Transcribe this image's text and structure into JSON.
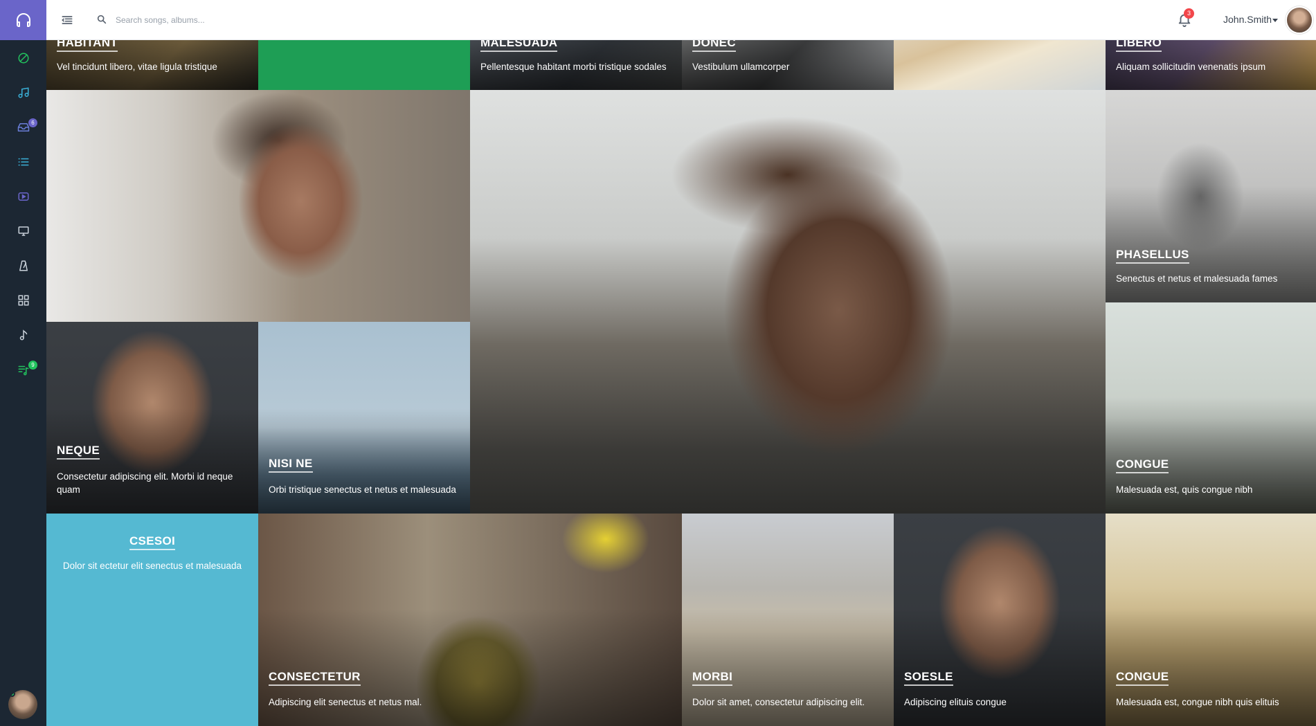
{
  "header": {
    "search_placeholder": "Search songs, albums...",
    "notification_count": "3",
    "user_name": "John.Smith"
  },
  "sidebar": {
    "items": [
      {
        "icon": "discover-icon",
        "color": "#22c35e"
      },
      {
        "icon": "music-note-icon",
        "color": "#3ab0d8"
      },
      {
        "icon": "inbox-icon",
        "color": "#6a7ed8",
        "badge": "6",
        "badge_color": "#6a65c9"
      },
      {
        "icon": "list-icon",
        "color": "#3ab0d8"
      },
      {
        "icon": "video-icon",
        "color": "#6a65c9"
      },
      {
        "icon": "monitor-icon",
        "color": "#c9d1da"
      },
      {
        "icon": "metronome-icon",
        "color": "#c9d1da"
      },
      {
        "icon": "grid-icon",
        "color": "#c9d1da"
      },
      {
        "icon": "eighth-note-icon",
        "color": "#c9d1da"
      },
      {
        "icon": "playlist-icon",
        "color": "#22c35e",
        "badge": "9",
        "badge_color": "#22c35e"
      }
    ]
  },
  "tiles": [
    {
      "id": "habitant",
      "title": "HABITANT",
      "subtitle": "Vel tincidunt libero, vitae ligula tristique"
    },
    {
      "id": "green-block",
      "title": "",
      "subtitle": ""
    },
    {
      "id": "malesuada",
      "title": "MALESUADA",
      "subtitle": "Pellentesque habitant morbi tristique sodales"
    },
    {
      "id": "donec",
      "title": "DONEC",
      "subtitle": "Vestibulum ullamcorper"
    },
    {
      "id": "macarons",
      "title": "",
      "subtitle": ""
    },
    {
      "id": "libero",
      "title": "LIBERO",
      "subtitle": "Aliquam sollicitudin venenatis ipsum"
    },
    {
      "id": "woman",
      "title": "",
      "subtitle": ""
    },
    {
      "id": "man-sunglasses",
      "title": "",
      "subtitle": ""
    },
    {
      "id": "phasellus",
      "title": "PHASELLUS",
      "subtitle": "Senectus et netus et malesuada fames"
    },
    {
      "id": "neque",
      "title": "NEQUE",
      "subtitle": "Consectetur adipiscing elit. Morbi id neque quam"
    },
    {
      "id": "nisi-ne",
      "title": "NISI NE",
      "subtitle": "Orbi tristique senectus et netus et malesuada"
    },
    {
      "id": "congue-1",
      "title": "CONGUE",
      "subtitle": "Malesuada est, quis congue nibh"
    },
    {
      "id": "csesoi",
      "title": "CSESOI",
      "subtitle": "Dolor sit ectetur elit senectus et malesuada"
    },
    {
      "id": "consectetur",
      "title": "CONSECTETUR",
      "subtitle": "Adipiscing elit senectus et netus mal."
    },
    {
      "id": "morbi",
      "title": "MORBI",
      "subtitle": "Dolor sit amet, consectetur adipiscing elit."
    },
    {
      "id": "soesle",
      "title": "SOESLE",
      "subtitle": "Adipiscing elituis congue"
    },
    {
      "id": "congue-2",
      "title": "CONGUE",
      "subtitle": "Malesuada est, congue nibh quis elituis"
    }
  ]
}
